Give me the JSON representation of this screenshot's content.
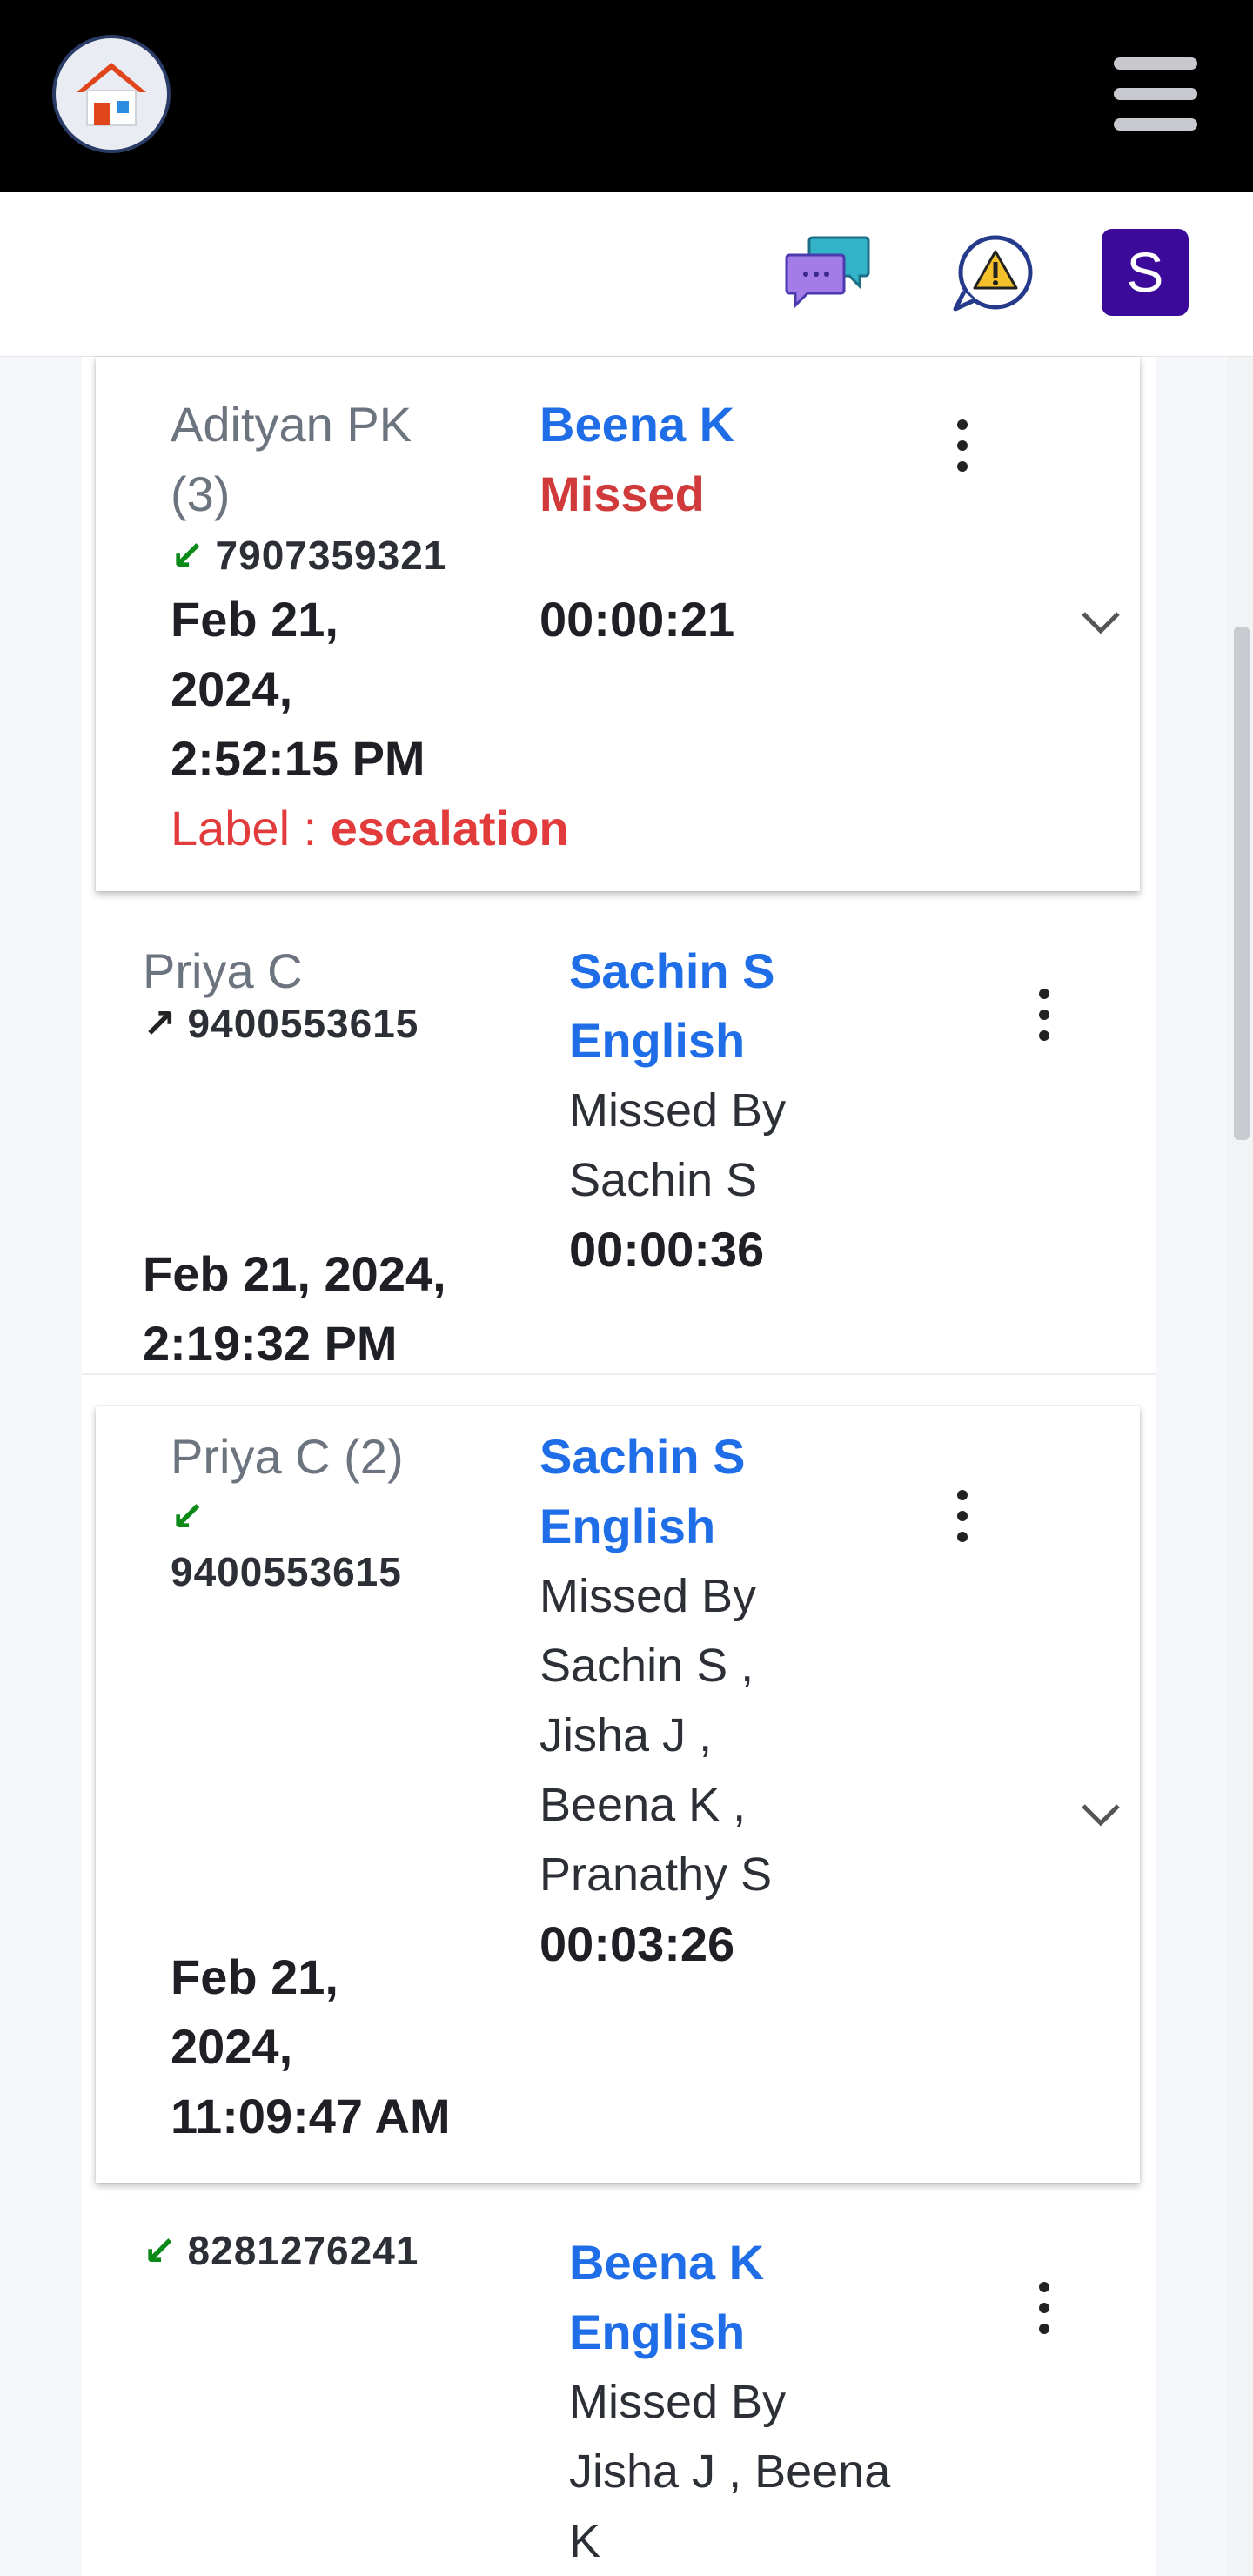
{
  "header": {
    "menu_icon": "hamburger-icon",
    "home_icon": "home-icon"
  },
  "subbar": {
    "chat_icon": "chat-bubbles-icon",
    "alert_icon": "warning-bubble-icon",
    "avatar_letter": "S"
  },
  "calls": [
    {
      "name": "Adityan PK",
      "count": "(3)",
      "direction": "incoming",
      "number": "7907359321",
      "date_line1": "Feb 21,",
      "date_line2": "2024,",
      "date_line3": "2:52:15 PM",
      "agent": "Beena K",
      "status": "Missed",
      "duration": "00:00:21",
      "label_prefix": "Label :",
      "label_value": "escalation"
    },
    {
      "name": "Priya C",
      "direction": "outgoing",
      "number": "9400553615",
      "date_line1": "Feb 21, 2024,",
      "date_line2": "2:19:32 PM",
      "agent": "Sachin S",
      "language": "English",
      "missed_by_line1": "Missed By",
      "missed_by_line2": "Sachin S",
      "duration": "00:00:36"
    },
    {
      "name": "Priya C (2)",
      "direction": "incoming",
      "number": "9400553615",
      "date_line1": "Feb 21,",
      "date_line2": "2024,",
      "date_line3": "11:09:47 AM",
      "agent": "Sachin S",
      "language": "English",
      "missed_by_line1": "Missed By",
      "missed_by_line2": "Sachin S ,",
      "missed_by_line3": "Jisha J ,",
      "missed_by_line4": "Beena K ,",
      "missed_by_line5": "Pranathy S",
      "duration": "00:03:26"
    },
    {
      "direction": "incoming",
      "number": "8281276241",
      "agent": "Beena K",
      "language": "English",
      "missed_by_line1": "Missed By",
      "missed_by_line2": "Jisha J , Beena",
      "missed_by_line3": "K"
    }
  ]
}
